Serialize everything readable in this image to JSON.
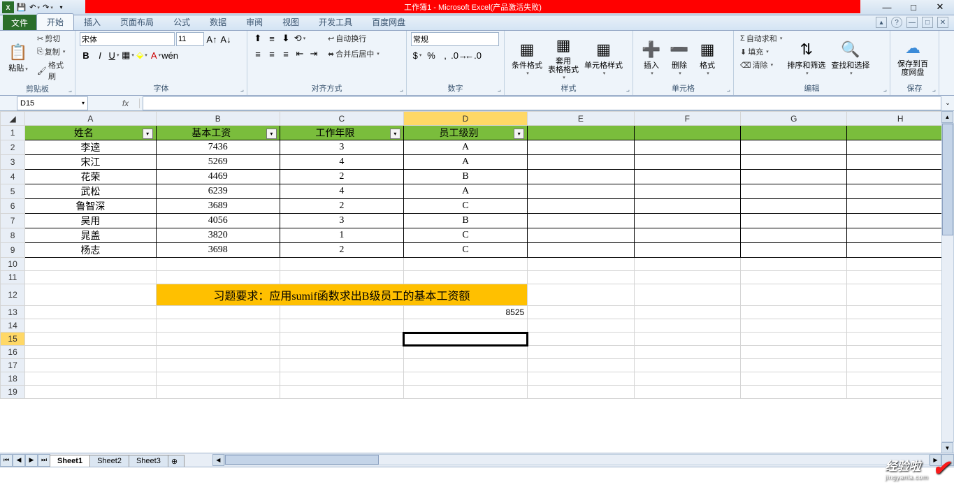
{
  "title": "工作簿1 - Microsoft Excel(产品激活失败)",
  "qat": {
    "save": "💾",
    "undo": "↶",
    "redo": "↷"
  },
  "win": {
    "min": "—",
    "max": "□",
    "close": "✕"
  },
  "tabs": {
    "file": "文件",
    "home": "开始",
    "insert": "插入",
    "layout": "页面布局",
    "formula": "公式",
    "data": "数据",
    "review": "审阅",
    "view": "视图",
    "dev": "开发工具",
    "baidu": "百度网盘"
  },
  "groups": {
    "clipboard": "剪贴板",
    "font": "字体",
    "align": "对齐方式",
    "number": "数字",
    "styles": "样式",
    "cells": "单元格",
    "editing": "编辑",
    "save": "保存"
  },
  "clipboard": {
    "paste": "粘贴",
    "cut": "剪切",
    "copy": "复制",
    "painter": "格式刷"
  },
  "font": {
    "name": "宋体",
    "size": "11"
  },
  "align": {
    "wrap": "自动换行",
    "merge": "合并后居中"
  },
  "number": {
    "format": "常规"
  },
  "styles": {
    "cond": "条件格式",
    "table": "套用\n表格格式",
    "cell": "单元格样式"
  },
  "cells": {
    "insert": "插入",
    "delete": "删除",
    "format": "格式"
  },
  "editing": {
    "sum": "自动求和",
    "fill": "填充",
    "clear": "清除",
    "sort": "排序和筛选",
    "find": "查找和选择"
  },
  "savegrp": {
    "label": "保存到百\n度网盘"
  },
  "namebox": "D15",
  "formula": "",
  "columns": [
    "A",
    "B",
    "C",
    "D",
    "E",
    "F",
    "G",
    "H"
  ],
  "header_row": [
    "姓名",
    "基本工资",
    "工作年限",
    "员工级别"
  ],
  "chart_data": {
    "type": "table",
    "columns": [
      "姓名",
      "基本工资",
      "工作年限",
      "员工级别"
    ],
    "rows": [
      [
        "李逵",
        "7436",
        "3",
        "A"
      ],
      [
        "宋江",
        "5269",
        "4",
        "A"
      ],
      [
        "花荣",
        "4469",
        "2",
        "B"
      ],
      [
        "武松",
        "6239",
        "4",
        "A"
      ],
      [
        "鲁智深",
        "3689",
        "2",
        "C"
      ],
      [
        "吴用",
        "4056",
        "3",
        "B"
      ],
      [
        "晁盖",
        "3820",
        "1",
        "C"
      ],
      [
        "杨志",
        "3698",
        "2",
        "C"
      ]
    ]
  },
  "task": "习题要求：应用sumif函数求出B级员工的基本工资额",
  "result": "8525",
  "sheets": [
    "Sheet1",
    "Sheet2",
    "Sheet3"
  ],
  "watermark": {
    "big": "经验啦",
    "small": "jingyanla.com"
  }
}
